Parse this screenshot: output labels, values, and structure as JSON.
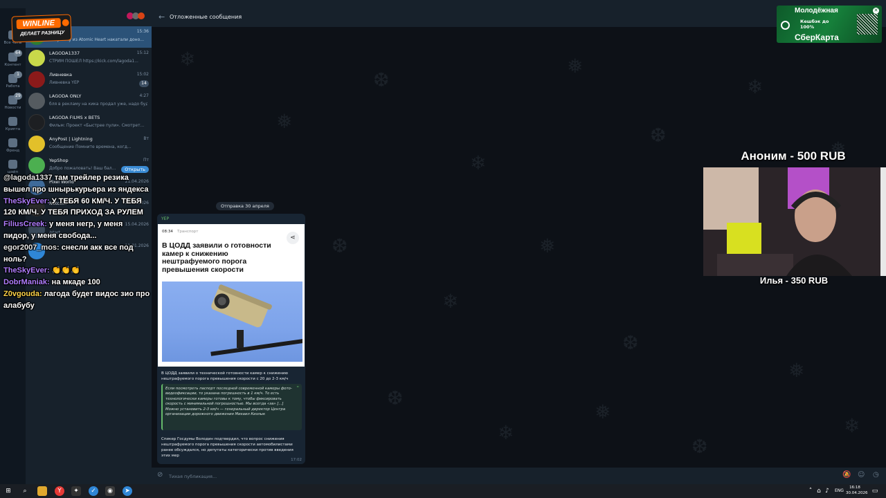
{
  "header": {
    "title": "Отложенные сообщения"
  },
  "folders": [
    {
      "label": "Все чаты",
      "badge": ""
    },
    {
      "label": "Контент",
      "badge": "64"
    },
    {
      "label": "Работа",
      "badge": "1"
    },
    {
      "label": "Новости",
      "badge": "29"
    },
    {
      "label": "Крипта",
      "badge": ""
    },
    {
      "label": "Френд",
      "badge": ""
    },
    {
      "label": "шэйп",
      "badge": ""
    }
  ],
  "chats": [
    {
      "name": "",
      "preview": "Ваву Бичу из Atomic Heart накатали доно...",
      "time": "15:36",
      "badge": "",
      "active": true,
      "avatar": "#2e7d32"
    },
    {
      "name": "LAGODA1337",
      "preview": "СТРИМ ПОШЕЛ https://kick.com/lagoda1...",
      "time": "15:12",
      "badge": "",
      "avatar": "#c8d94a"
    },
    {
      "name": "Ливневка",
      "preview": "Ливневка YEP",
      "time": "15:02",
      "badge": "14",
      "avatar": "#8b1a1a"
    },
    {
      "name": "LAGODA ONLY",
      "preview": "бля в рекламу на кика продал уже, надо буд...",
      "time": "4:27",
      "badge": "",
      "avatar": "#555b60"
    },
    {
      "name": "LAGODA FILMS x BETS",
      "preview": "Фильм: Проект «Быстрее пули». Смотрет...",
      "time": "",
      "badge": "",
      "avatar": "#1d1f22"
    },
    {
      "name": "AnyPost | Lightning",
      "preview": "Сообщение Помните времена, когд...",
      "time": "Вт",
      "badge": "",
      "avatar": "#e2c02a"
    },
    {
      "name": "YepShop",
      "preview": "Добро пожаловать! Ваш бал...",
      "time": "Пт",
      "badge": "",
      "open_button": "Открыть",
      "avatar": "#4caf50"
    },
    {
      "name": "Pixel World",
      "preview": "Pixel World",
      "time": "21.04.2026",
      "badge": "",
      "avatar": "#3e6a9a"
    },
    {
      "name": "Notcoin",
      "preview": "",
      "time": "21.04.2026",
      "badge": "",
      "avatar": "#2a2a2a"
    },
    {
      "name": "",
      "preview": "",
      "time": "15.04.2026",
      "badge": "",
      "avatar": "#3a4a5a"
    },
    {
      "name": "",
      "preview": "/start",
      "time": "11.01.2026",
      "badge": "",
      "avatar": "#2f86d6"
    }
  ],
  "message": {
    "date_label": "Отправка 30 апреля",
    "sender": "YEP",
    "article": {
      "time": "08:34",
      "category": "Транспорт",
      "headline": "В ЦОДД заявили о готовности камер к снижению нештрафуемого порога превышения скорости"
    },
    "caption": "В ЦОДД заявили о технической готовности камер к снижению нештрафуемого порога превышения скорости с 20 до 2-3 км/ч",
    "quote": "Если посмотреть паспорт последней современной камеры фото-видеофиксации, то указана погрешность в 1 км/ч. То есть технологически камеры готовы к тому, чтобы фиксировать скорость с минимальной погрешностью. Мы всегда «за» [...] Можно установить 2-3 км/ч — генеральный директор Центра организации дорожного движения Михаил Кизлык",
    "body": "Спикер Госдумы Володин подтвердил, что вопрос снижения нештрафуемого порога превышения скорости автомобилистами ранее обсуждался, но депутаты категорически против введения этих мер",
    "time": "17:02"
  },
  "input": {
    "placeholder": "Тихая публикация..."
  },
  "overlays": {
    "winline": {
      "name": "WINLINE",
      "tagline": "ДЕЛАЕТ РАЗНИЦУ"
    },
    "sber": {
      "top": "Молодёжная",
      "cashback": "Кешбэк до 100%",
      "brand": "СберКарта"
    },
    "donation_title": "Аноним - 500 RUB",
    "donation_sub": "Илья - 350 RUB"
  },
  "stream_chat": [
    {
      "user": "@lagoda1337",
      "text": " там трейлер резика вышел про шнырькурьера из яндекса",
      "style": "alt"
    },
    {
      "user": "TheSkyEver:",
      "text": " У ТЕБЯ 60 КМ/Ч. У ТЕБЯ 120 КМ/Ч. У ТЕБЯ ПРИХОД ЗА РУЛЕМ",
      "style": ""
    },
    {
      "user": "FiliusCreek:",
      "text": " у меня негр, у меня пидор, у меня свобода...",
      "style": ""
    },
    {
      "user": "egor2007_mos:",
      "text": " снесли акк все под ноль?",
      "style": ""
    },
    {
      "user": "TheSkyEver:",
      "text": " 👏👏👏",
      "style": ""
    },
    {
      "user": "DobrManiak:",
      "text": " на мкаде 100",
      "style": ""
    },
    {
      "user": "Z0vgouda:",
      "text": " лагода будет видос зио про алабубу",
      "style": "gold"
    }
  ],
  "taskbar": {
    "lang": "ENG",
    "time": "16:18",
    "date": "30.04.2026"
  },
  "colors": {
    "accent": "#2b5278",
    "bg": "#0e1621",
    "panel": "#17212b",
    "sender": "#66bb6a",
    "winline": "#ff6a00",
    "sber": "#16803b"
  }
}
